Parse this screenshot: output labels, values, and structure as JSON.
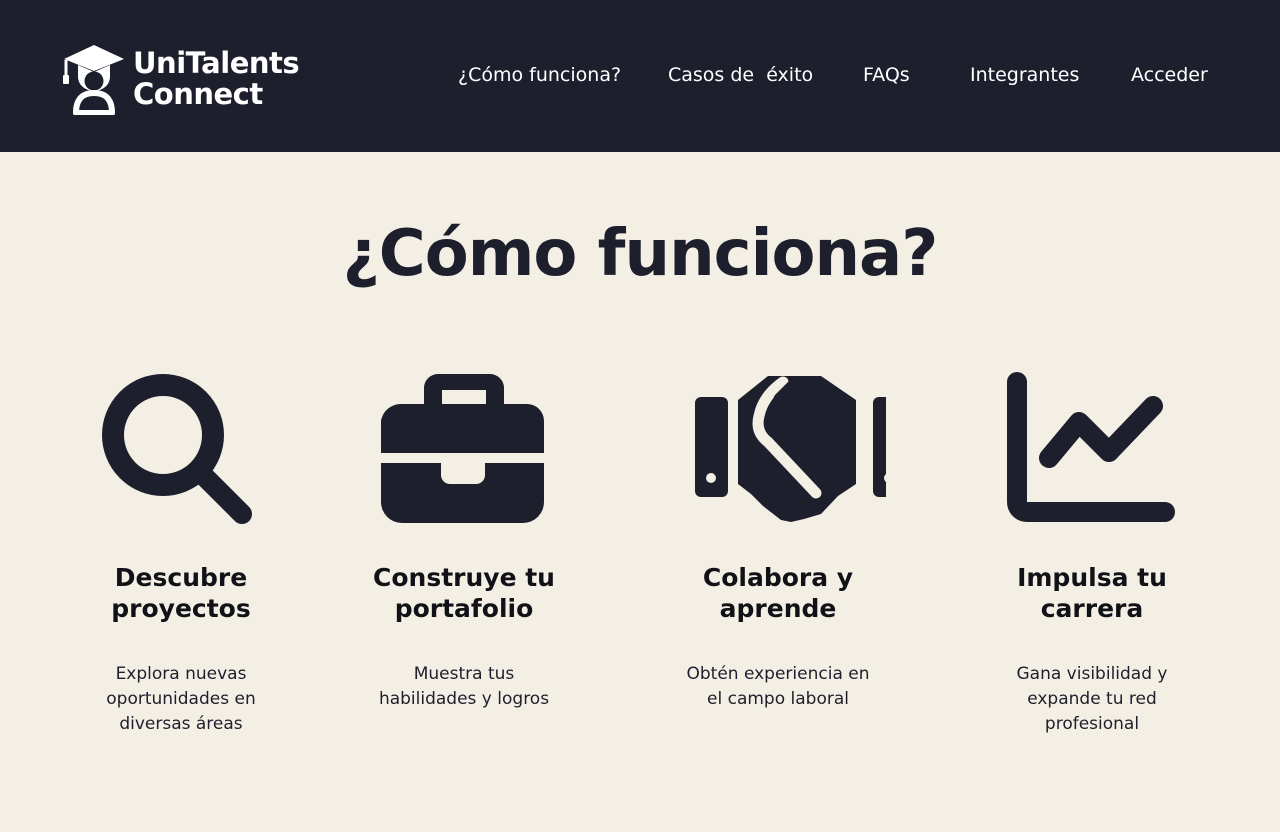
{
  "brand": {
    "line1": "UniTalents",
    "line2": "Connect",
    "logo_icon": "graduate-person-icon"
  },
  "nav": {
    "items": [
      {
        "label": "¿Cómo funciona?"
      },
      {
        "label": "Casos de  éxito"
      },
      {
        "label": "FAQs"
      },
      {
        "label": "Integrantes"
      },
      {
        "label": "Acceder"
      }
    ]
  },
  "how_it_works": {
    "title": "¿Cómo funciona?",
    "features": [
      {
        "icon": "search-icon",
        "title": "Descubre proyectos",
        "description": "Explora nuevas oportunidades en diversas áreas"
      },
      {
        "icon": "briefcase-icon",
        "title": "Construye tu portafolio",
        "description": "Muestra tus habilidades y logros"
      },
      {
        "icon": "handshake-icon",
        "title": "Colabora y aprende",
        "description": "Obtén experiencia en el campo laboral"
      },
      {
        "icon": "chart-line-icon",
        "title": "Impulsa tu carrera",
        "description": "Gana visibilidad y expande tu red profesional"
      }
    ]
  },
  "colors": {
    "header_bg": "#1e1f2c",
    "page_bg": "#f3efe5",
    "text": "#1e1f2c",
    "header_text": "#ffffff"
  }
}
